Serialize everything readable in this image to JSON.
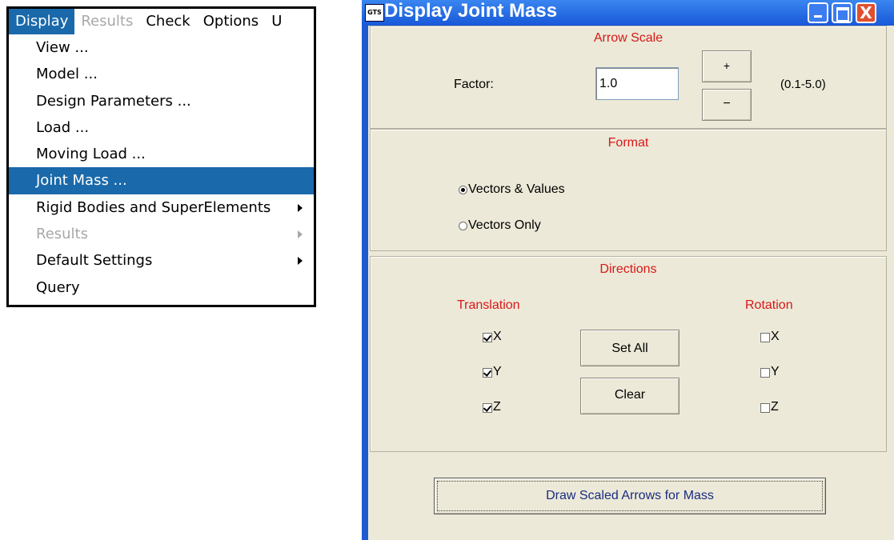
{
  "menubar": {
    "items": [
      {
        "label": "Display",
        "state": "active"
      },
      {
        "label": "Results",
        "state": "disabled"
      },
      {
        "label": "Check",
        "state": "normal"
      },
      {
        "label": "Options",
        "state": "normal"
      },
      {
        "label": "U",
        "state": "normal"
      }
    ]
  },
  "display_menu": {
    "items": [
      {
        "label": "View ...",
        "submenu": false,
        "state": "normal"
      },
      {
        "label": "Model ...",
        "submenu": false,
        "state": "normal"
      },
      {
        "label": "Design Parameters ...",
        "submenu": false,
        "state": "normal"
      },
      {
        "label": "Load  ...",
        "submenu": false,
        "state": "normal"
      },
      {
        "label": "Moving Load ...",
        "submenu": false,
        "state": "normal"
      },
      {
        "label": "Joint Mass ...",
        "submenu": false,
        "state": "selected"
      },
      {
        "label": "Rigid Bodies and SuperElements",
        "submenu": true,
        "state": "normal"
      },
      {
        "label": "Results",
        "submenu": true,
        "state": "disabled"
      },
      {
        "label": "Default Settings",
        "submenu": true,
        "state": "normal"
      },
      {
        "label": "Query",
        "submenu": false,
        "state": "normal"
      }
    ]
  },
  "window": {
    "app_icon": "GTS",
    "title": "Display Joint Mass",
    "controls": {
      "minimize": "minimize-icon",
      "maximize": "maximize-icon",
      "close": "close-icon"
    },
    "close_glyph": "X"
  },
  "arrow_scale": {
    "title": "Arrow Scale",
    "factor_label": "Factor:",
    "factor_value": "1.0",
    "plus_label": "+",
    "minus_label": "−",
    "range": "(0.1-5.0)"
  },
  "format": {
    "title": "Format",
    "options": [
      {
        "label": "Vectors & Values",
        "selected": true
      },
      {
        "label": "Vectors Only",
        "selected": false
      }
    ]
  },
  "directions": {
    "title": "Directions",
    "translation_label": "Translation",
    "rotation_label": "Rotation",
    "translation": [
      {
        "label": "X",
        "checked": true
      },
      {
        "label": "Y",
        "checked": true
      },
      {
        "label": "Z",
        "checked": true
      }
    ],
    "rotation": [
      {
        "label": "X",
        "checked": false
      },
      {
        "label": "Y",
        "checked": false
      },
      {
        "label": "Z",
        "checked": false
      }
    ],
    "set_all_label": "Set All",
    "clear_label": "Clear"
  },
  "draw_button_label": "Draw Scaled Arrows for Mass",
  "colors": {
    "menu_highlight": "#1a69aa",
    "title_bar": "#1f5bd0",
    "dialog_bg": "#ece9d8",
    "group_title": "#d81818",
    "draw_button_text": "#1a2c80"
  }
}
